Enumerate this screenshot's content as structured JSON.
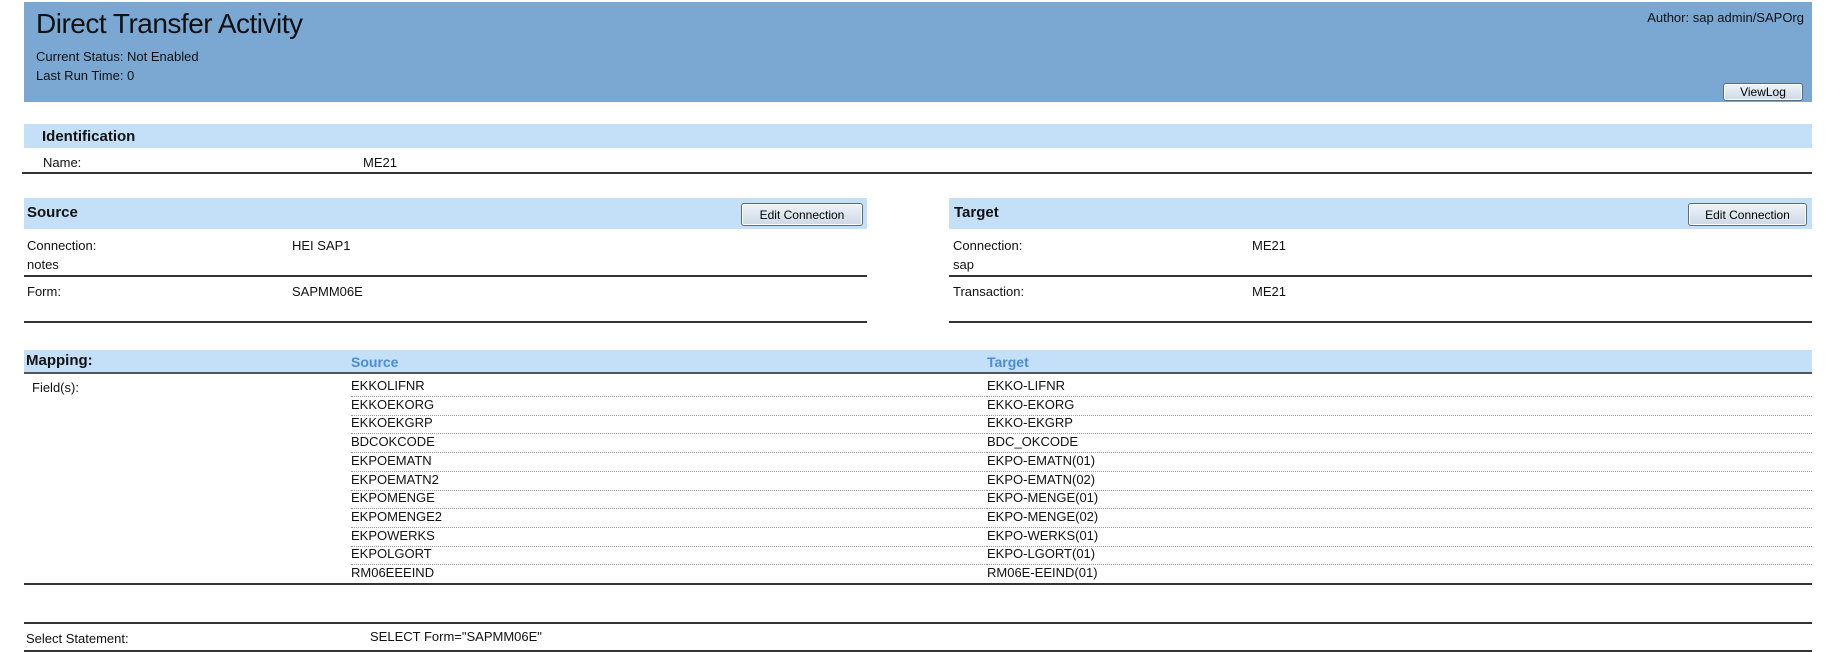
{
  "header": {
    "title": "Direct Transfer Activity",
    "status": "Current Status: Not Enabled",
    "last_run": "Last Run Time:  0",
    "author": "Author: sap admin/SAPOrg",
    "view_log": "ViewLog"
  },
  "identification": {
    "heading": "Identification",
    "name_label": "Name:",
    "name_value": "ME21"
  },
  "source": {
    "heading": "Source",
    "edit": "Edit Connection",
    "conn_label": "Connection:",
    "conn_sub": "notes",
    "conn_value": "HEI SAP1",
    "form_label": "Form:",
    "form_value": "SAPMM06E"
  },
  "target": {
    "heading": "Target",
    "edit": "Edit Connection",
    "conn_label": "Connection:",
    "conn_sub": "sap",
    "conn_value": "ME21",
    "trans_label": "Transaction:",
    "trans_value": "ME21"
  },
  "mapping": {
    "heading": "Mapping:",
    "source_col": "Source",
    "target_col": "Target",
    "fields_label": "Field(s):",
    "rows": [
      [
        "EKKOLIFNR",
        "EKKO-LIFNR"
      ],
      [
        "EKKOEKORG",
        "EKKO-EKORG"
      ],
      [
        "EKKOEKGRP",
        "EKKO-EKGRP"
      ],
      [
        "BDCOKCODE",
        "BDC_OKCODE"
      ],
      [
        "EKPOEMATN",
        "EKPO-EMATN(01)"
      ],
      [
        "EKPOEMATN2",
        "EKPO-EMATN(02)"
      ],
      [
        "EKPOMENGE",
        "EKPO-MENGE(01)"
      ],
      [
        "EKPOMENGE2",
        "EKPO-MENGE(02)"
      ],
      [
        "EKPOWERKS",
        "EKPO-WERKS(01)"
      ],
      [
        "EKPOLGORT",
        "EKPO-LGORT(01)"
      ],
      [
        "RM06EEEIND",
        "RM06E-EEIND(01)"
      ]
    ]
  },
  "select": {
    "label": "Select Statement:",
    "value": "SELECT Form=\"SAPMM06E\""
  }
}
